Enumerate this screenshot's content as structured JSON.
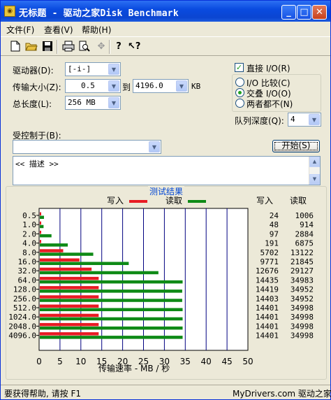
{
  "window": {
    "title": "无标题 - 驱动之家Disk Benchmark",
    "title_icon": "app-disk-icon"
  },
  "menu": [
    "文件(F)",
    "查看(V)",
    "帮助(H)"
  ],
  "toolbar_icons": [
    "new-file-icon",
    "open-folder-icon",
    "save-icon",
    "print-icon",
    "print-preview-icon",
    "move-icon",
    "help-icon",
    "context-help-icon"
  ],
  "form": {
    "drive_label": "驱动器(D):",
    "drive_value": "[-i-]",
    "transfer_label": "传输大小(Z):",
    "transfer_from": "0.5",
    "transfer_to_label": "到",
    "transfer_to": "4196.0",
    "transfer_unit": "KB",
    "total_label": "总长度(L):",
    "total_value": "256 MB",
    "controlled_label": "受控制于(B):",
    "controlled_value": "",
    "direct_io": "直接 I/O(R)",
    "direct_io_checked": true,
    "radio_compare": "I/O 比较(C)",
    "radio_overlap": "交叠 I/O(O)",
    "radio_neither": "两者都不(N)",
    "selected_radio": "overlap",
    "queue_label": "队列深度(Q):",
    "queue_value": "4",
    "start_button": "开始(S)",
    "description": "<< 描述 >>"
  },
  "results": {
    "title": "测试结果",
    "legend_write": "写入",
    "legend_read": "读取",
    "col_write": "写入",
    "col_read": "读取",
    "xlabel": "传输速率 - MB / 秒",
    "colors": {
      "write": "#e81b23",
      "read": "#0e8a16",
      "grid": "#000080"
    }
  },
  "chart_data": {
    "type": "bar",
    "orientation": "horizontal",
    "categories": [
      "0.5",
      "1.0",
      "2.0",
      "4.0",
      "8.0",
      "16.0",
      "32.0",
      "64.0",
      "128.0",
      "256.0",
      "512.0",
      "1024.0",
      "2048.0",
      "4096.0"
    ],
    "xlim": [
      0,
      50
    ],
    "xticks": [
      0,
      5,
      10,
      15,
      20,
      25,
      30,
      35,
      40,
      45,
      50
    ],
    "xlabel": "传输速率 - MB / 秒",
    "grid": true,
    "series": [
      {
        "name": "写入",
        "values": [
          0.02,
          0.05,
          0.1,
          0.2,
          5.6,
          9.5,
          12.4,
          14.1,
          14.1,
          14.1,
          14.1,
          14.1,
          14.1,
          14.1
        ]
      },
      {
        "name": "读取",
        "values": [
          1.0,
          0.9,
          2.8,
          6.7,
          12.8,
          21.3,
          28.4,
          34.2,
          34.1,
          34.1,
          34.2,
          34.2,
          34.2,
          34.2
        ]
      }
    ],
    "table": {
      "write": [
        "24",
        "48",
        "97",
        "191",
        "5702",
        "9771",
        "12676",
        "14435",
        "14419",
        "14403",
        "14401",
        "14401",
        "14401",
        "14401"
      ],
      "read": [
        "1006",
        "914",
        "2884",
        "6875",
        "13122",
        "21845",
        "29127",
        "34983",
        "34952",
        "34952",
        "34998",
        "34998",
        "34998",
        "34998"
      ]
    }
  },
  "status": {
    "help": "要获得帮助, 请按 F1",
    "site": "MyDrivers.com 驱动之家"
  }
}
